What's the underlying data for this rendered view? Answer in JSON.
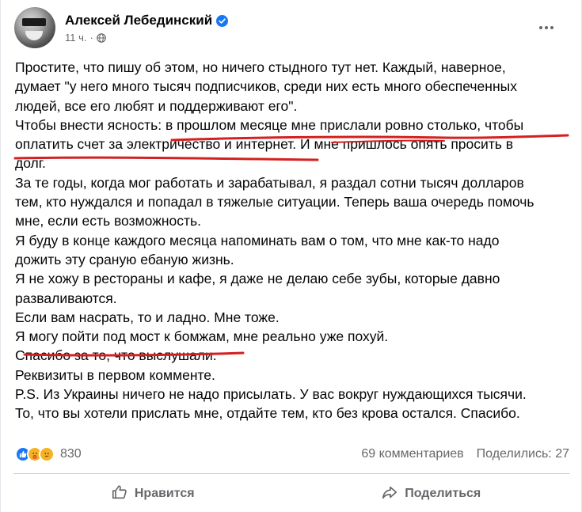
{
  "post": {
    "author": "Алексей Лебединский",
    "time": "11 ч.",
    "separator": "·",
    "lines": [
      "Простите, что пишу об этом, но ничего стыдного тут нет. Каждый, наверное,",
      "думает \"у него много тысяч подписчиков, среди них есть много обеспеченных",
      "людей, все его любят и поддерживают его\".",
      "Чтобы внести ясность: в прошлом месяце мне прислали ровно столько, чтобы",
      "оплатить счет за электричество и интернет. И мне пришлось опять просить в",
      "долг.",
      "За те годы, когда мог работать и зарабатывал, я раздал сотни тысяч долларов",
      "тем, кто нуждался и попадал в тяжелые ситуации. Теперь ваша очередь помочь",
      "мне, если есть возможность.",
      "Я буду в конце каждого месяца напоминать вам о том, что мне как-то надо",
      "дожить эту сраную ебаную жизнь.",
      "Я не хожу в рестораны и кафе, я даже не делаю себе зубы, которые давно",
      "разваливаются.",
      "Если вам насрать, то и ладно. Мне тоже.",
      "Я могу пойти под мост к бомжам, мне реально уже похуй.",
      "Спасибо за то, что выслушали.",
      "Реквизиты в первом комменте.",
      "P.S. Из Украины ничего не надо присылать. У вас вокруг нуждающихся тысячи.",
      "То, что вы хотели прислать мне, отдайте тем, кто без крова остался. Спасибо."
    ]
  },
  "stats": {
    "reactions_count": "830",
    "comments": "69 комментариев",
    "shares": "Поделились: 27"
  },
  "actions": {
    "like": "Нравится",
    "share": "Поделиться"
  },
  "colors": {
    "verified": "#1877f2",
    "underline": "#d42020",
    "muted": "#65676b"
  }
}
